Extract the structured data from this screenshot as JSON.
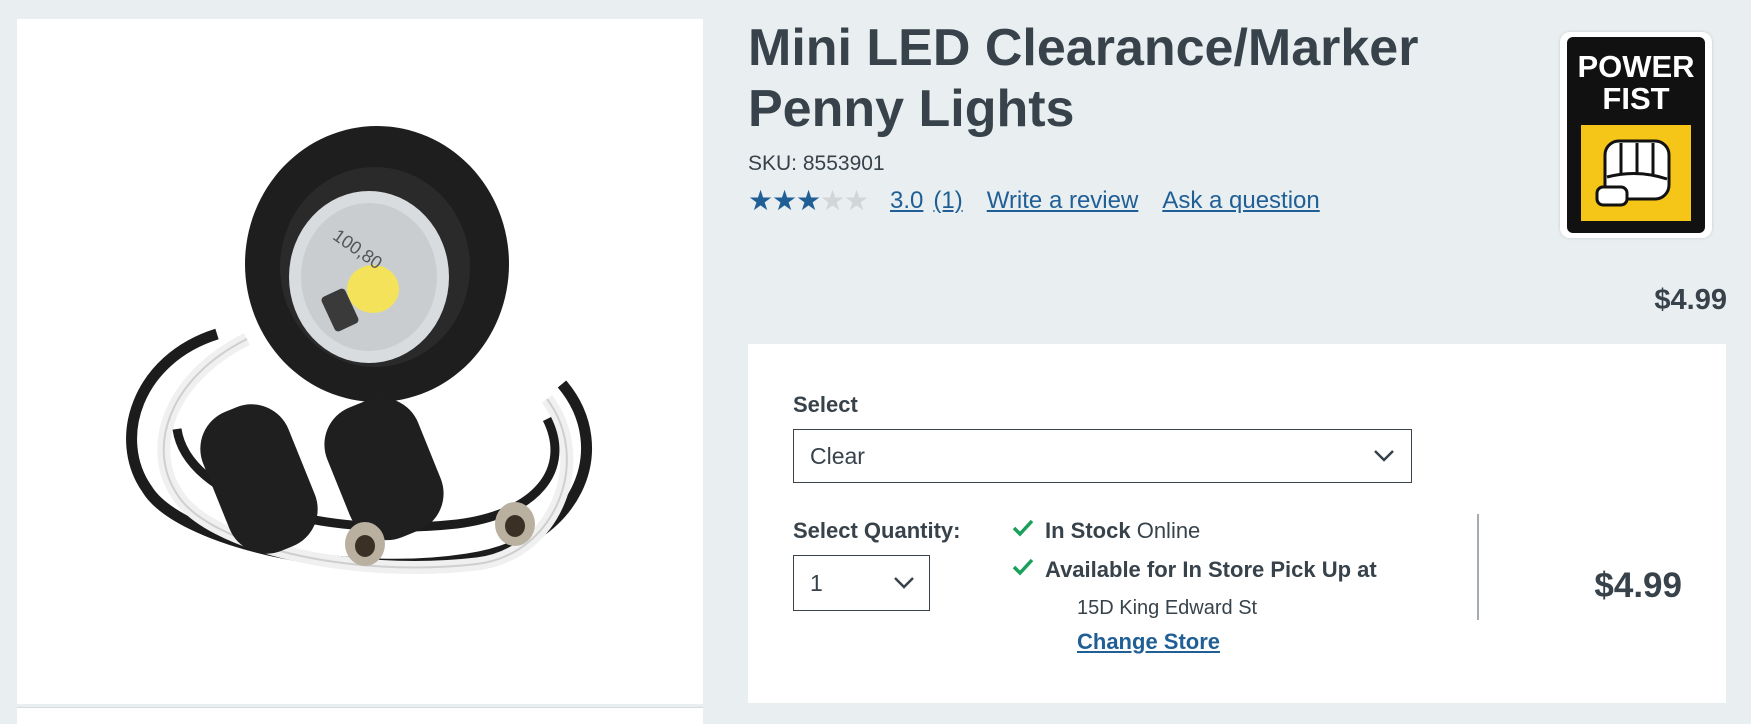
{
  "product": {
    "title_line1": "Mini LED Clearance/Marker",
    "title_line2": "Penny Lights",
    "sku": "SKU: 8553901",
    "rating": 3.0,
    "rating_text": "3.0",
    "review_count_text": "(1)",
    "write_review": "Write a review",
    "ask_question": "Ask a question",
    "price": "$4.99",
    "image_alt": "Mini LED clearance marker penny light with wires",
    "image_print": "100,80"
  },
  "brand": {
    "logo_text_1": "POWER",
    "logo_text_2": "FIST"
  },
  "purchase": {
    "select_label": "Select",
    "select_value": "Clear",
    "quantity_label": "Select Quantity:",
    "quantity_value": "1",
    "in_stock_strong": "In Stock",
    "in_stock_rest": "Online",
    "pickup_text": "Available for In Store Pick Up at",
    "store_address": "15D King Edward St",
    "change_store": "Change Store",
    "price": "$4.99"
  },
  "colors": {
    "accent": "#1f5f96",
    "check": "#1aa05a",
    "text": "#37424a",
    "background": "#e9eef0"
  },
  "icons": [
    "star-icon",
    "chevron-down-icon",
    "checkmark-icon",
    "fist-icon"
  ]
}
